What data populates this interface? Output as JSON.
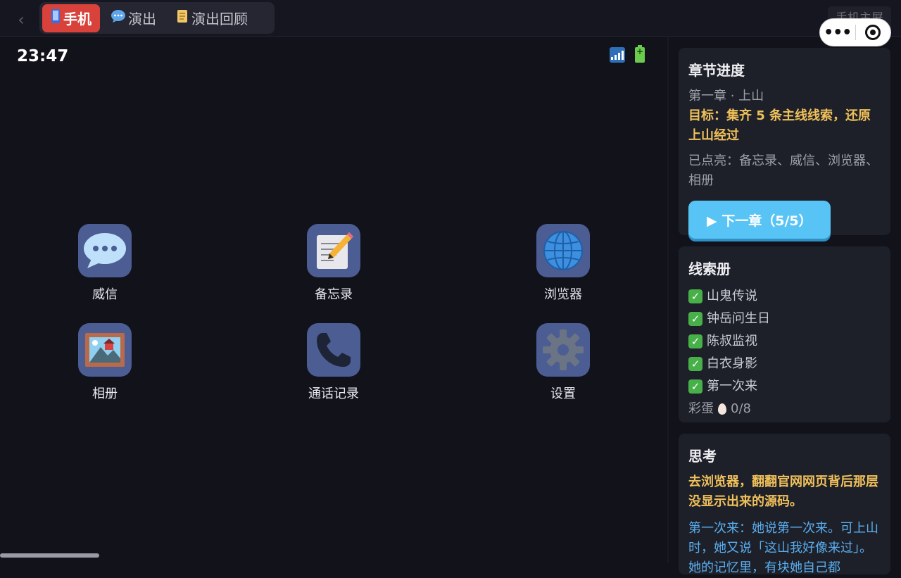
{
  "topbar": {
    "back_glyph": "‹",
    "tabs": [
      {
        "icon": "mobile-phone-icon",
        "label": "手机",
        "active": true
      },
      {
        "icon": "speech-bubble-icon",
        "label": "演出",
        "active": false
      },
      {
        "icon": "scroll-icon",
        "label": "演出回顾",
        "active": false
      }
    ],
    "screen_label": "手机主屏"
  },
  "phone": {
    "time": "23:47",
    "apps": [
      {
        "icon": "speech-bubble-icon",
        "label": "威信"
      },
      {
        "icon": "memo-icon",
        "label": "备忘录"
      },
      {
        "icon": "globe-icon",
        "label": "浏览器"
      },
      {
        "icon": "photo-album-icon",
        "label": "相册"
      },
      {
        "icon": "telephone-icon",
        "label": "通话记录"
      },
      {
        "icon": "gear-icon",
        "label": "设置"
      }
    ]
  },
  "progress": {
    "title": "章节进度",
    "chapter": "第一章 · 上山",
    "goal": "目标：集齐 5 条主线线索，还原上山经过",
    "lit": "已点亮：备忘录、威信、浏览器、相册",
    "next_button": "▶ 下一章（5/5）"
  },
  "clues": {
    "title": "线索册",
    "items": [
      "山鬼传说",
      "钟岳问生日",
      "陈叔监视",
      "白衣身影",
      "第一次来"
    ],
    "easter_label": "彩蛋",
    "easter_count": "0/8"
  },
  "thinking": {
    "title": "思考",
    "hint": "去浏览器，翻翻官网网页背后那层没显示出来的源码。",
    "note": "第一次来：她说第一次来。可上山时，她又说「这山我好像来过」。她的记忆里，有块她自己都"
  },
  "colors": {
    "active_tab": "#d9413b",
    "next_button": "#58c4f5",
    "gold_text": "#f0c05a",
    "blue_text": "#5aaef0",
    "app_tile": "#4b5d93"
  }
}
